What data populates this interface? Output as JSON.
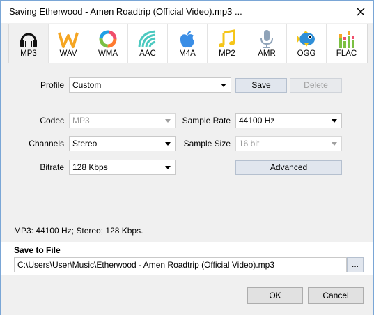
{
  "window": {
    "title": "Saving Etherwood - Amen Roadtrip (Official Video).mp3 ..."
  },
  "tabs": [
    {
      "label": "MP3",
      "icon": "headphones-icon",
      "active": true
    },
    {
      "label": "WAV",
      "icon": "wav-icon"
    },
    {
      "label": "WMA",
      "icon": "wma-icon"
    },
    {
      "label": "AAC",
      "icon": "aac-icon"
    },
    {
      "label": "M4A",
      "icon": "apple-icon"
    },
    {
      "label": "MP2",
      "icon": "music-note-icon"
    },
    {
      "label": "AMR",
      "icon": "microphone-icon"
    },
    {
      "label": "OGG",
      "icon": "fish-icon"
    },
    {
      "label": "FLAC",
      "icon": "equalizer-icon"
    }
  ],
  "profile": {
    "label": "Profile",
    "value": "Custom",
    "save": "Save",
    "delete": "Delete"
  },
  "codec": {
    "label": "Codec",
    "value": "MP3"
  },
  "channels": {
    "label": "Channels",
    "value": "Stereo"
  },
  "bitrate": {
    "label": "Bitrate",
    "value": "128 Kbps"
  },
  "sample_rate": {
    "label": "Sample Rate",
    "value": "44100 Hz"
  },
  "sample_size": {
    "label": "Sample Size",
    "value": "16 bit"
  },
  "advanced": "Advanced",
  "summary": "MP3:  44100  Hz; Stereo;  128 Kbps.",
  "save_to_file": {
    "title": "Save to File",
    "path": "C:\\Users\\User\\Music\\Etherwood - Amen Roadtrip (Official Video).mp3",
    "browse": "..."
  },
  "footer": {
    "ok": "OK",
    "cancel": "Cancel"
  },
  "colors": {
    "border": "#7aa6d6",
    "button": "#e1e6ee",
    "panel": "#f0f0f0"
  }
}
